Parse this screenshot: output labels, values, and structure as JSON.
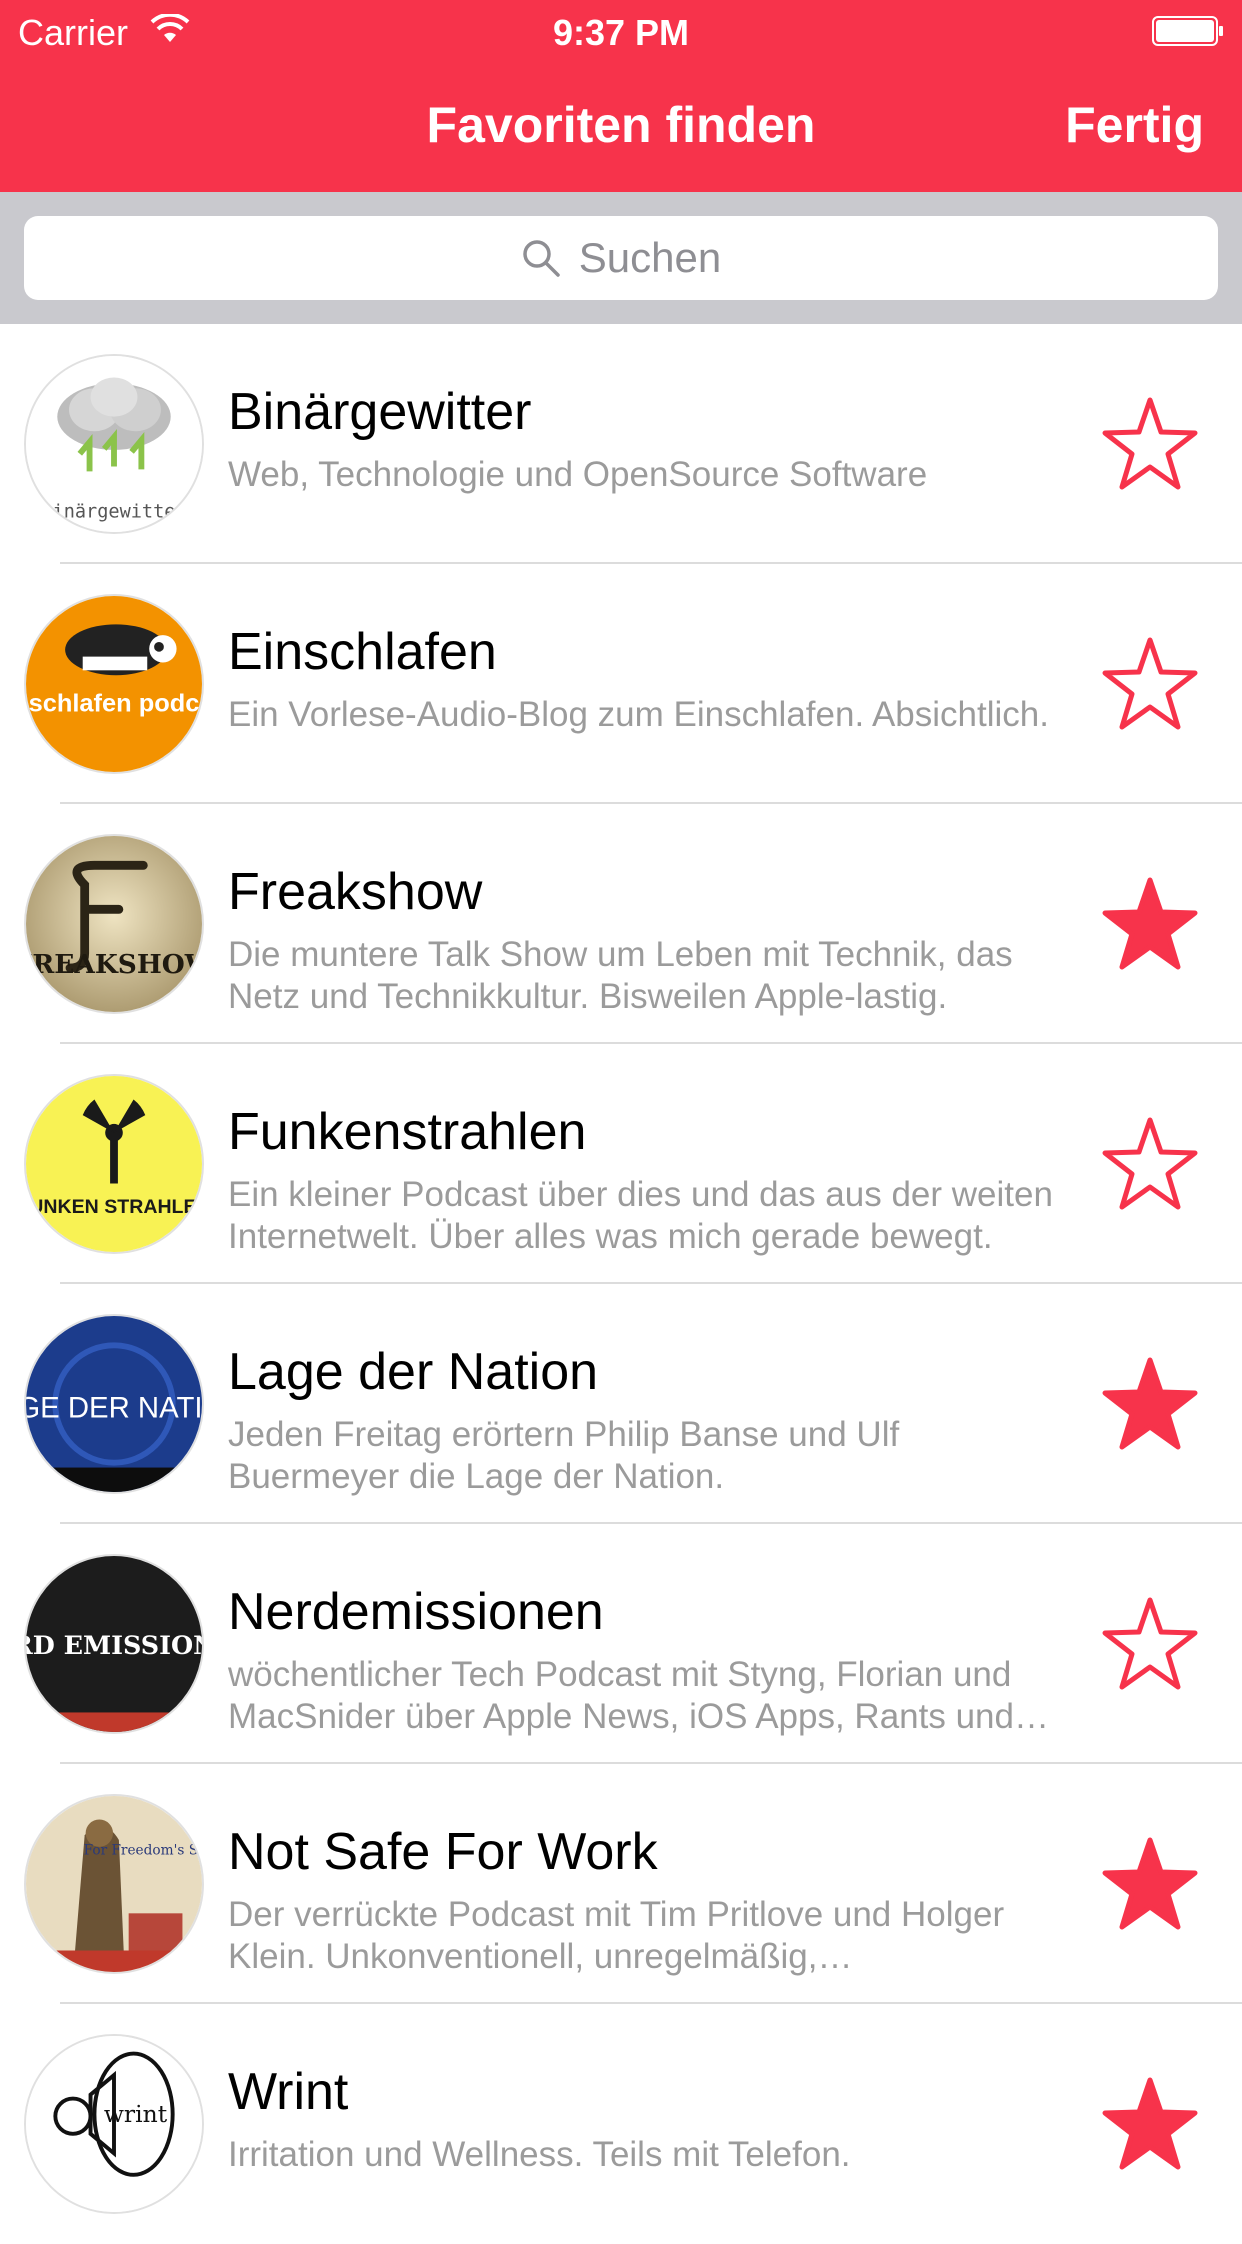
{
  "status_bar": {
    "carrier": "Carrier",
    "time": "9:37 PM"
  },
  "nav": {
    "title": "Favoriten finden",
    "done_label": "Fertig"
  },
  "search": {
    "placeholder": "Suchen"
  },
  "colors": {
    "accent": "#f7334b",
    "separator": "#dcdcdc",
    "secondary_text": "#9b9b9b"
  },
  "podcasts": [
    {
      "title": "Binärgewitter",
      "description": "Web, Technologie und OpenSource Software",
      "favorite": false,
      "artwork_text": "binärgewitter"
    },
    {
      "title": "Einschlafen",
      "description": "Ein Vorlese-Audio-Blog zum Einschlafen. Absichtlich.",
      "favorite": false,
      "artwork_text": "einschlafen podcast"
    },
    {
      "title": "Freakshow",
      "description": "Die muntere Talk Show um Leben mit Technik, das Netz und Technikkultur. Bisweilen Apple-lastig.",
      "favorite": true,
      "artwork_text": "FREAKSHOW"
    },
    {
      "title": "Funkenstrahlen",
      "description": "Ein kleiner Podcast über dies und das aus der weiten Internetwelt. Über alles was mich gerade bewegt.",
      "favorite": false,
      "artwork_text": "FUNKEN STRAHLEN"
    },
    {
      "title": "Lage der Nation",
      "description": "Jeden Freitag erörtern Philip Banse und Ulf Buermeyer die Lage der Nation.",
      "favorite": true,
      "artwork_text": "LAGE DER NATION"
    },
    {
      "title": "Nerdemissionen",
      "description": "wöchentlicher Tech Podcast mit Styng, Florian und MacSnider über Apple News, iOS Apps, Rants und mehr.",
      "favorite": false,
      "artwork_text": "NERD EMISSIONEN"
    },
    {
      "title": "Not Safe For Work",
      "description": "Der verrückte Podcast mit Tim Pritlove und Holger Klein. Unkonventionell, unregelmäßig, unvorhersehbar.",
      "favorite": true,
      "artwork_text": "For Freedom's Sake"
    },
    {
      "title": "Wrint",
      "description": "Irritation und Wellness. Teils mit Telefon.",
      "favorite": true,
      "artwork_text": "wrint"
    }
  ]
}
